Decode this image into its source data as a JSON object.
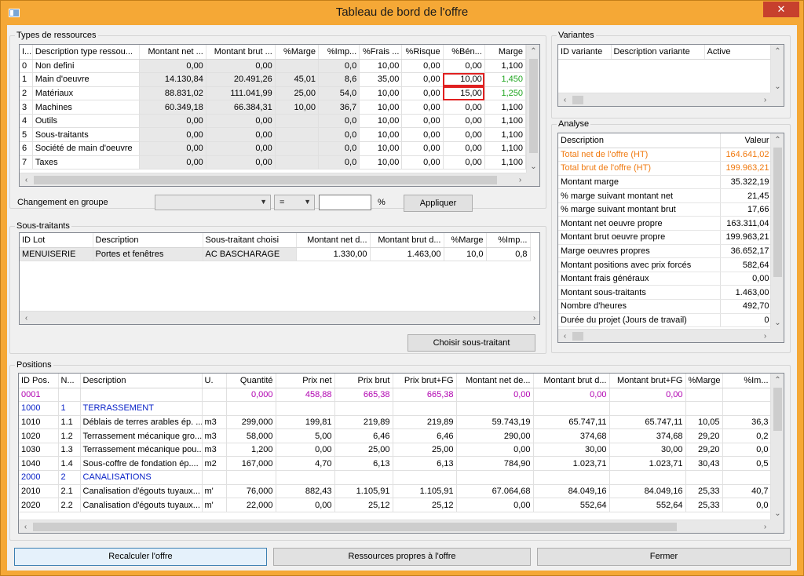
{
  "window": {
    "title": "Tableau de bord de l'offre",
    "close_glyph": "✕"
  },
  "types": {
    "legend": "Types de ressources",
    "columns": [
      "I...",
      "Description type ressou...",
      "Montant net ...",
      "Montant brut ...",
      "%Marge",
      "%Imp...",
      "%Frais ...",
      "%Risque",
      "%Bén...",
      "Marge"
    ],
    "rows": [
      [
        "0",
        "Non defini",
        "0,00",
        "0,00",
        "",
        "0,0",
        "10,00",
        "0,00",
        "0,00",
        "1,100"
      ],
      [
        "1",
        "Main d'oeuvre",
        "14.130,84",
        "20.491,26",
        "45,01",
        "8,6",
        "35,00",
        "0,00",
        "10,00",
        "1,450"
      ],
      [
        "2",
        "Matériaux",
        "88.831,02",
        "111.041,99",
        "25,00",
        "54,0",
        "10,00",
        "0,00",
        "15,00",
        "1,250"
      ],
      [
        "3",
        "Machines",
        "60.349,18",
        "66.384,31",
        "10,00",
        "36,7",
        "10,00",
        "0,00",
        "0,00",
        "1,100"
      ],
      [
        "4",
        "Outils",
        "0,00",
        "0,00",
        "",
        "0,0",
        "10,00",
        "0,00",
        "0,00",
        "1,100"
      ],
      [
        "5",
        "Sous-traitants",
        "0,00",
        "0,00",
        "",
        "0,0",
        "10,00",
        "0,00",
        "0,00",
        "1,100"
      ],
      [
        "6",
        "Société de main d'oeuvre",
        "0,00",
        "0,00",
        "",
        "0,0",
        "10,00",
        "0,00",
        "0,00",
        "1,100"
      ],
      [
        "7",
        "Taxes",
        "0,00",
        "0,00",
        "",
        "0,0",
        "10,00",
        "0,00",
        "0,00",
        "1,100"
      ]
    ]
  },
  "group": {
    "label": "Changement en groupe",
    "combo1_value": "",
    "combo2_value": "=",
    "input_value": "",
    "percent": "%",
    "apply": "Appliquer"
  },
  "variantes": {
    "legend": "Variantes",
    "columns": [
      "ID variante",
      "Description variante",
      "Active"
    ]
  },
  "sous_traitants": {
    "legend": "Sous-traitants",
    "columns": [
      "ID Lot",
      "Description",
      "Sous-traitant choisi",
      "Montant net d...",
      "Montant brut d...",
      "%Marge",
      "%Imp..."
    ],
    "rows": [
      [
        "MENUISERIE",
        "Portes et fenêtres",
        "AC BASCHARAGE",
        "1.330,00",
        "1.463,00",
        "10,0",
        "0,8"
      ]
    ],
    "choose_button": "Choisir sous-traitant"
  },
  "analyse": {
    "legend": "Analyse",
    "columns": [
      "Description",
      "Valeur"
    ],
    "rows": [
      [
        "Total net de l'offre (HT)",
        "164.641,02"
      ],
      [
        "Total brut de l'offre (HT)",
        "199.963,21"
      ],
      [
        "Montant marge",
        "35.322,19"
      ],
      [
        "% marge suivant montant net",
        "21,45"
      ],
      [
        "% marge suivant montant brut",
        "17,66"
      ],
      [
        "Montant net oeuvre propre",
        "163.311,04"
      ],
      [
        "Montant brut oeuvre propre",
        "199.963,21"
      ],
      [
        "Marge oeuvres propres",
        "36.652,17"
      ],
      [
        "Montant positions avec prix forcés",
        "582,64"
      ],
      [
        "Montant frais généraux",
        "0,00"
      ],
      [
        "Montant sous-traitants",
        "1.463,00"
      ],
      [
        "Nombre d'heures",
        "492,70"
      ],
      [
        "Durée du projet (Jours de travail)",
        "0"
      ]
    ]
  },
  "positions": {
    "legend": "Positions",
    "columns": [
      "ID Pos.",
      "N...",
      "Description",
      "U.",
      "Quantité",
      "Prix net",
      "Prix brut",
      "Prix brut+FG",
      "Montant net de...",
      "Montant brut d...",
      "Montant brut+FG",
      "%Marge",
      "%Im..."
    ],
    "rows": [
      [
        "0001",
        "",
        "",
        "",
        "0,000",
        "458,88",
        "665,38",
        "665,38",
        "0,00",
        "0,00",
        "0,00",
        "",
        ""
      ],
      [
        "1000",
        "1",
        "TERRASSEMENT",
        "",
        "",
        "",
        "",
        "",
        "",
        "",
        "",
        "",
        ""
      ],
      [
        "1010",
        "1.1",
        "Déblais de terres arables ép. ...",
        "m3",
        "299,000",
        "199,81",
        "219,89",
        "219,89",
        "59.743,19",
        "65.747,11",
        "65.747,11",
        "10,05",
        "36,3"
      ],
      [
        "1020",
        "1.2",
        "Terrassement mécanique gro...",
        "m3",
        "58,000",
        "5,00",
        "6,46",
        "6,46",
        "290,00",
        "374,68",
        "374,68",
        "29,20",
        "0,2"
      ],
      [
        "1030",
        "1.3",
        "Terrassement mécanique pou...",
        "m3",
        "1,200",
        "0,00",
        "25,00",
        "25,00",
        "0,00",
        "30,00",
        "30,00",
        "29,20",
        "0,0"
      ],
      [
        "1040",
        "1.4",
        "Sous-coffre de fondation ép....",
        "m2",
        "167,000",
        "4,70",
        "6,13",
        "6,13",
        "784,90",
        "1.023,71",
        "1.023,71",
        "30,43",
        "0,5"
      ],
      [
        "2000",
        "2",
        "CANALISATIONS",
        "",
        "",
        "",
        "",
        "",
        "",
        "",
        "",
        "",
        ""
      ],
      [
        "2010",
        "2.1",
        "Canalisation d'égouts tuyaux...",
        "m'",
        "76,000",
        "882,43",
        "1.105,91",
        "1.105,91",
        "67.064,68",
        "84.049,16",
        "84.049,16",
        "25,33",
        "40,7"
      ],
      [
        "2020",
        "2.2",
        "Canalisation d'égouts tuyaux...",
        "m'",
        "22,000",
        "0,00",
        "25,12",
        "25,12",
        "0,00",
        "552,64",
        "552,64",
        "25,33",
        "0,0"
      ]
    ]
  },
  "footer": {
    "recalc": "Recalculer l'offre",
    "ressources": "Ressources propres à l'offre",
    "fermer": "Fermer"
  }
}
